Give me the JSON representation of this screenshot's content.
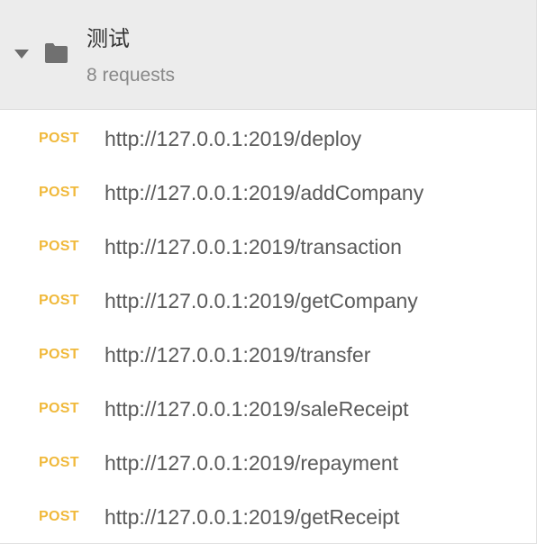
{
  "collection": {
    "name": "测试",
    "count_label": "8 requests",
    "expanded": true,
    "toggle_icon": "caret-down-icon",
    "folder_icon": "folder-icon"
  },
  "colors": {
    "method_post": "#f0b93b",
    "header_bg": "#ececec",
    "url_text": "#5a5a5a"
  },
  "requests": [
    {
      "method": "POST",
      "url": "http://127.0.0.1:2019/deploy"
    },
    {
      "method": "POST",
      "url": "http://127.0.0.1:2019/addCompany"
    },
    {
      "method": "POST",
      "url": "http://127.0.0.1:2019/transaction"
    },
    {
      "method": "POST",
      "url": "http://127.0.0.1:2019/getCompany"
    },
    {
      "method": "POST",
      "url": "http://127.0.0.1:2019/transfer"
    },
    {
      "method": "POST",
      "url": "http://127.0.0.1:2019/saleReceipt"
    },
    {
      "method": "POST",
      "url": "http://127.0.0.1:2019/repayment"
    },
    {
      "method": "POST",
      "url": "http://127.0.0.1:2019/getReceipt"
    }
  ]
}
